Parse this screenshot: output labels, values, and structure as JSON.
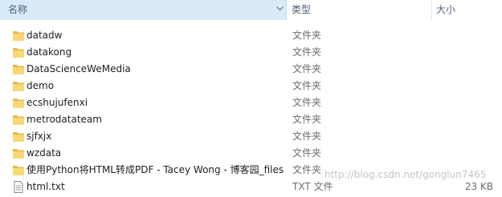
{
  "header": {
    "name_label": "名称",
    "type_label": "类型",
    "size_label": "大小",
    "sort_indicator": "^",
    "dropdown_indicator": "v"
  },
  "files": [
    {
      "name": "datadw",
      "type": "文件夹",
      "size": "",
      "icon": "folder-icon"
    },
    {
      "name": "datakong",
      "type": "文件夹",
      "size": "",
      "icon": "folder-icon"
    },
    {
      "name": "DataScienceWeMedia",
      "type": "文件夹",
      "size": "",
      "icon": "folder-icon"
    },
    {
      "name": "demo",
      "type": "文件夹",
      "size": "",
      "icon": "folder-icon"
    },
    {
      "name": "ecshujufenxi",
      "type": "文件夹",
      "size": "",
      "icon": "folder-icon"
    },
    {
      "name": "metrodatateam",
      "type": "文件夹",
      "size": "",
      "icon": "folder-icon"
    },
    {
      "name": "sjfxjx",
      "type": "文件夹",
      "size": "",
      "icon": "folder-icon"
    },
    {
      "name": "wzdata",
      "type": "文件夹",
      "size": "",
      "icon": "folder-icon"
    },
    {
      "name": "使用Python将HTML转成PDF - Tacey Wong - 博客园_files",
      "type": "文件夹",
      "size": "",
      "icon": "folder-icon"
    },
    {
      "name": "html.txt",
      "type": "TXT 文件",
      "size": "23 KB",
      "icon": "text-file-icon"
    }
  ],
  "watermark": "http://blog.csdn.net/gonglun7465",
  "colors": {
    "header_selected_bg": "#d9ebf9",
    "header_text": "#4c607a",
    "folder_yellow": "#f8d775",
    "folder_dark": "#e8b94a",
    "secondary_text": "#6d6d6d"
  }
}
